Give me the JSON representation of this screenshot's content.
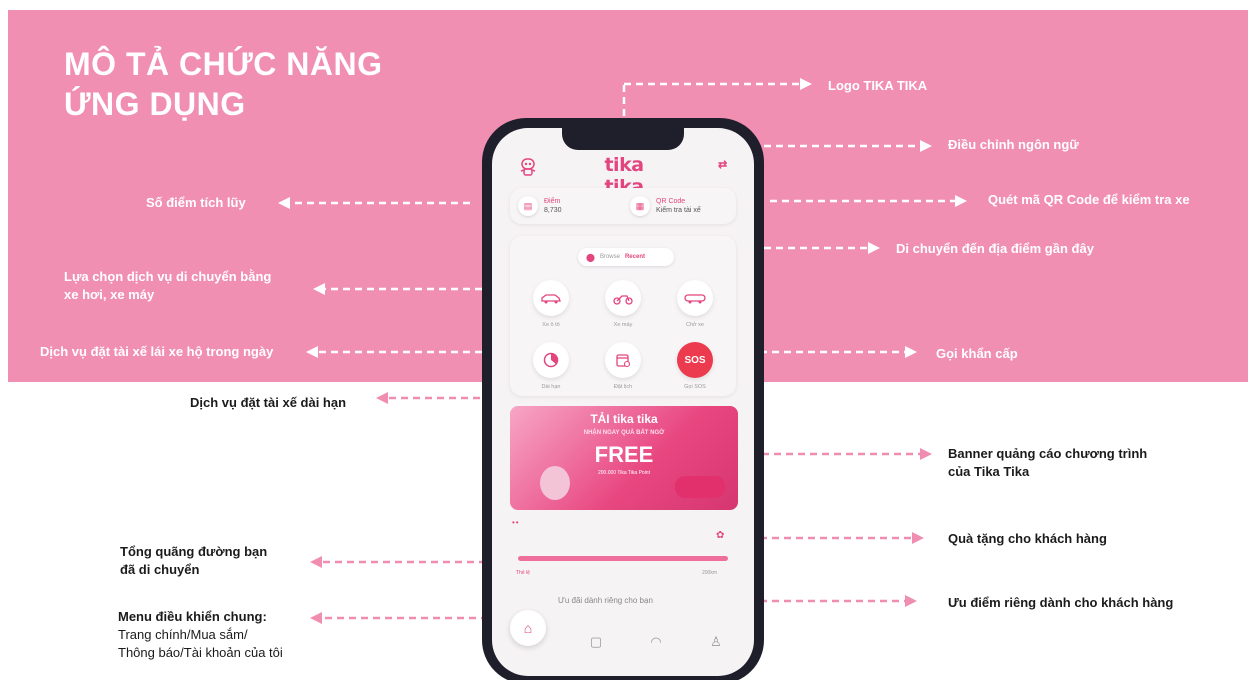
{
  "title": {
    "line1": "MÔ TẢ CHỨC NĂNG",
    "line2": "ỨNG DỤNG"
  },
  "annotations": {
    "logo": "Logo TIKA TIKA",
    "language": "Điều chỉnh ngôn ngữ",
    "points": "Số điểm tích lũy",
    "qr": "Quét mã QR Code để kiểm tra xe",
    "recent": "Di chuyển đến địa điểm gần đây",
    "vehicle_line1": "Lựa chọn dịch vụ di chuyển bằng",
    "vehicle_line2": "xe hơi, xe máy",
    "driver_day": "Dịch vụ đặt tài xế lái xe hộ trong ngày",
    "sos": "Gọi khẩn cấp",
    "driver_long": "Dịch vụ đặt tài xế dài hạn",
    "banner_line1": "Banner quảng cáo chương trình",
    "banner_line2": "của Tika Tika",
    "gift": "Quà tặng cho khách hàng",
    "distance_line1": "Tổng quãng đường bạn",
    "distance_line2": "đã di chuyển",
    "benefit": "Ưu điểm riêng dành cho khách hàng",
    "menu_title": "Menu điều khiển chung:",
    "menu_line1": "Trang chính/Mua sắm/",
    "menu_line2": "Thông báo/Tài khoản của tôi"
  },
  "app": {
    "logo_text": "tika tika",
    "points_label": "Điểm",
    "points_value": "8,730",
    "qr_label": "QR Code",
    "qr_value": "Kiểm tra tài xế",
    "recent_prefix": "Browse",
    "recent_value": "Recent",
    "services": [
      {
        "label": "Xe ô tô",
        "icon": "car-icon"
      },
      {
        "label": "Xe máy",
        "icon": "motorbike-icon"
      },
      {
        "label": "Chở xe",
        "icon": "car-transport-icon"
      },
      {
        "label": "Dài hạn",
        "icon": "pie-icon"
      },
      {
        "label": "Đặt lịch",
        "icon": "calendar-icon"
      },
      {
        "label": "Gọi SOS",
        "icon": "sos-icon",
        "text": "SOS"
      }
    ],
    "banner": {
      "title": "TẢI tika tika",
      "subtitle": "NHẬN NGAY QUÀ BẤT NGỜ",
      "headline": "FREE",
      "small": "200.000 Tika Tika Point"
    },
    "distance_start": "Thẻ lệ",
    "distance_end": "200km",
    "promo_text": "Ưu đãi dành riêng cho bạn"
  },
  "colors": {
    "band": "#f18fb3",
    "accent": "#e3457e",
    "sos": "#ec3b4e",
    "phone": "#1f1f2b"
  }
}
